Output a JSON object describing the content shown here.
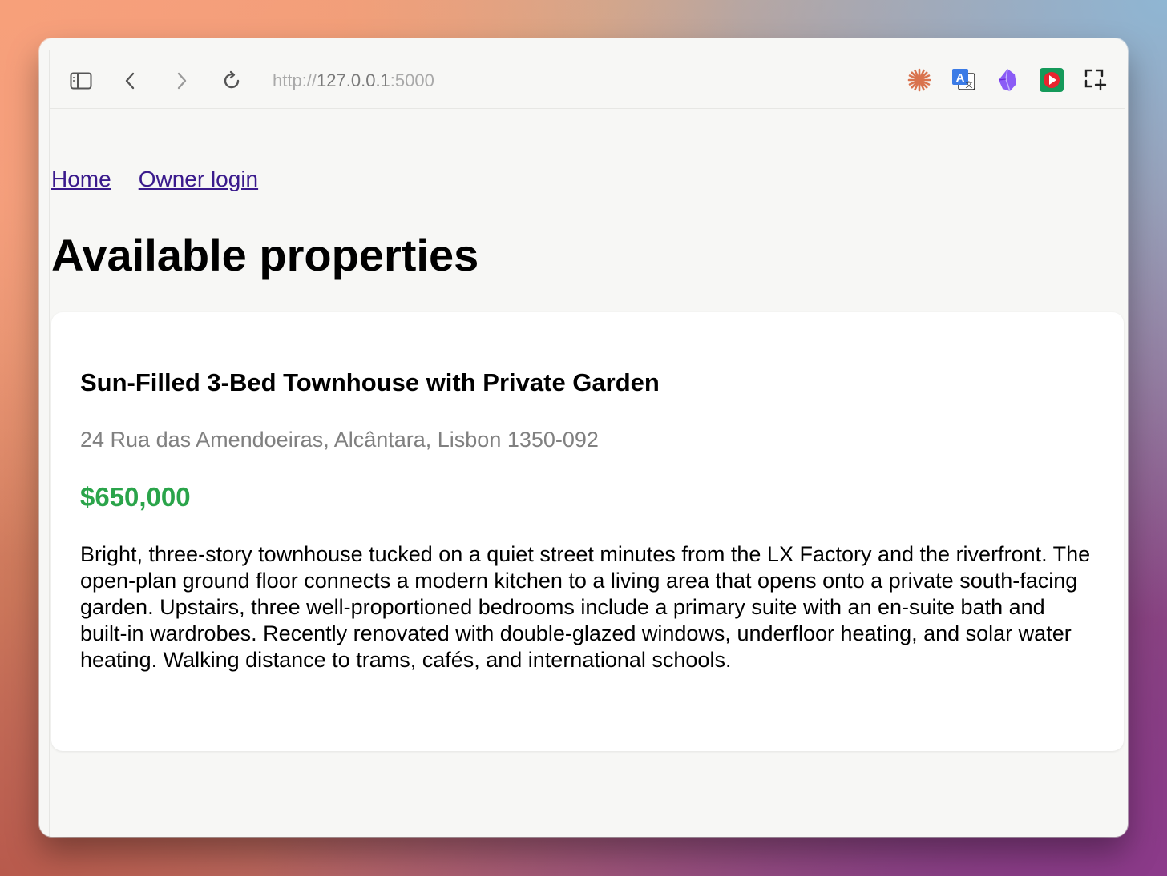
{
  "browser": {
    "url_scheme": "http://",
    "url_host": "127.0.0.1",
    "url_port": ":5000",
    "extensions": [
      {
        "name": "claude-icon",
        "color": "#d9734e"
      },
      {
        "name": "translate-icon",
        "color": "#3b7be6"
      },
      {
        "name": "obsidian-icon",
        "color": "#8b5cf6"
      },
      {
        "name": "video-speed-icon",
        "color": "#159a5a"
      },
      {
        "name": "screenshot-icon",
        "color": "#222222"
      }
    ]
  },
  "nav": {
    "home": "Home",
    "owner_login": "Owner login"
  },
  "page": {
    "title": "Available properties"
  },
  "property": {
    "title": "Sun-Filled 3-Bed Townhouse with Private Garden",
    "address": "24 Rua das Amendoeiras, Alcântara, Lisbon 1350-092",
    "price": "$650,000",
    "description": "Bright, three-story townhouse tucked on a quiet street minutes from the LX Factory and the riverfront. The open-plan ground floor connects a modern kitchen to a living area that opens onto a private south-facing garden. Upstairs, three well-proportioned bedrooms include a primary suite with an en-suite bath and built-in wardrobes. Recently renovated with double-glazed windows, underfloor heating, and solar water heating. Walking distance to trams, cafés, and international schools."
  },
  "colors": {
    "link": "#3a1a8c",
    "price": "#2aa44a",
    "muted": "#808080"
  }
}
